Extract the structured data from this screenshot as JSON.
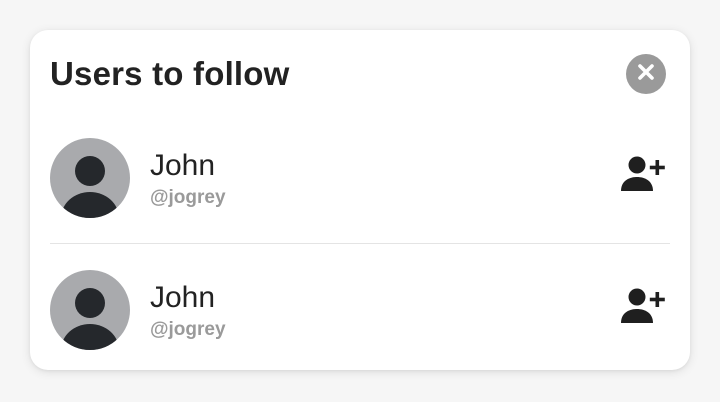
{
  "panel": {
    "title": "Users to follow"
  },
  "users": [
    {
      "name": "John",
      "handle": "@jogrey"
    },
    {
      "name": "John",
      "handle": "@jogrey"
    }
  ],
  "icons": {
    "close": "close-icon",
    "follow": "person-add-icon",
    "avatar": "default-avatar-icon"
  },
  "colors": {
    "background": "#f6f6f6",
    "card": "#ffffff",
    "title_text": "#222222",
    "handle_text": "#9a9a9a",
    "close_button": "#9a9a9a",
    "avatar_bg": "#a9aaad",
    "avatar_figure": "#25282c",
    "divider": "#e4e4e4"
  }
}
